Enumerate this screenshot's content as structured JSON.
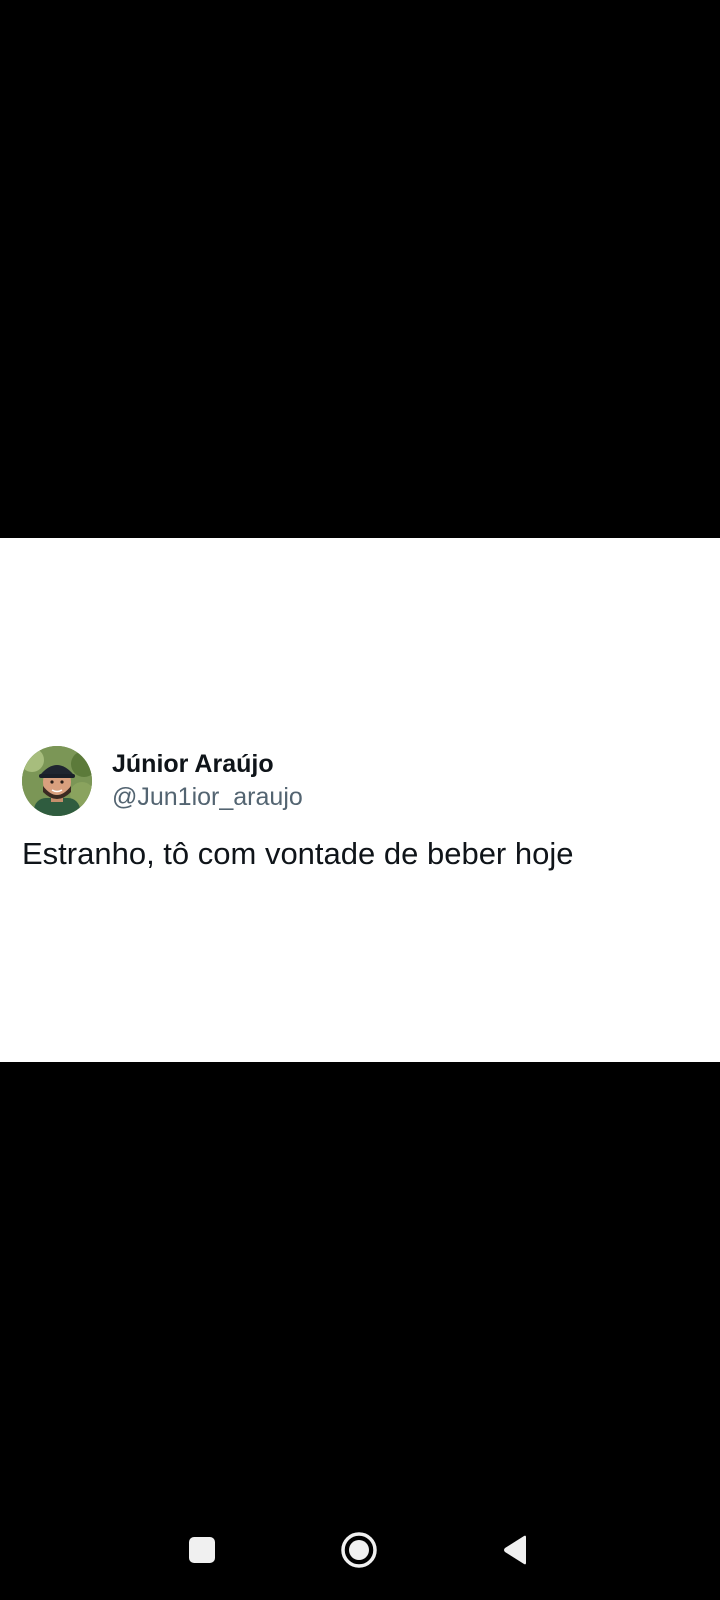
{
  "tweet": {
    "display_name": "Júnior Araújo",
    "handle": "@Jun1ior_araujo",
    "text": "Estranho, tô com vontade de beber hoje",
    "avatar_icon": "profile-photo-avatar"
  },
  "navigation": {
    "recents_icon": "square-icon",
    "home_icon": "circle-home-icon",
    "back_icon": "triangle-back-icon"
  },
  "colors": {
    "background": "#000000",
    "card": "#ffffff",
    "primary_text": "#0f1419",
    "secondary_text": "#536471",
    "nav_icon": "#f0f0f0"
  }
}
